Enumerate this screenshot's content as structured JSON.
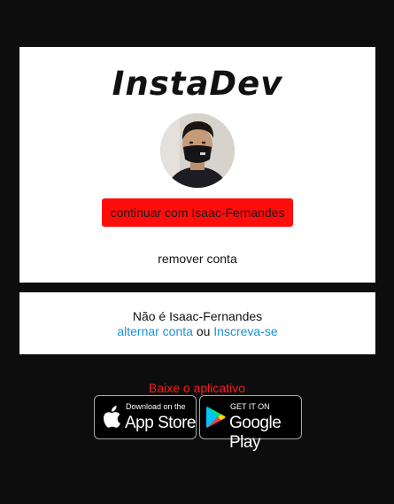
{
  "brand": {
    "logo_text": "InstaDev"
  },
  "account": {
    "avatar_alt": "avatar",
    "continue_label": "continuar com Isaac-Fernandes",
    "remove_label": "remover conta"
  },
  "switch": {
    "not_user_text": "Não é Isaac-Fernandes",
    "switch_link": "alternar conta",
    "or_text": " ou ",
    "signup_link": "Inscreva-se"
  },
  "download": {
    "label": "Baixe o aplicativo",
    "app_store": {
      "small": "Download on the",
      "big": "App Store",
      "icon": "apple-icon"
    },
    "google_play": {
      "small": "GET IT ON",
      "big": "Google Play",
      "icon": "google-play-icon"
    }
  },
  "colors": {
    "background": "#0d0d0d",
    "card": "#ffffff",
    "primary_button": "#ff0d0d",
    "link": "#1a8fd6",
    "download_label": "#ff1a1a"
  }
}
